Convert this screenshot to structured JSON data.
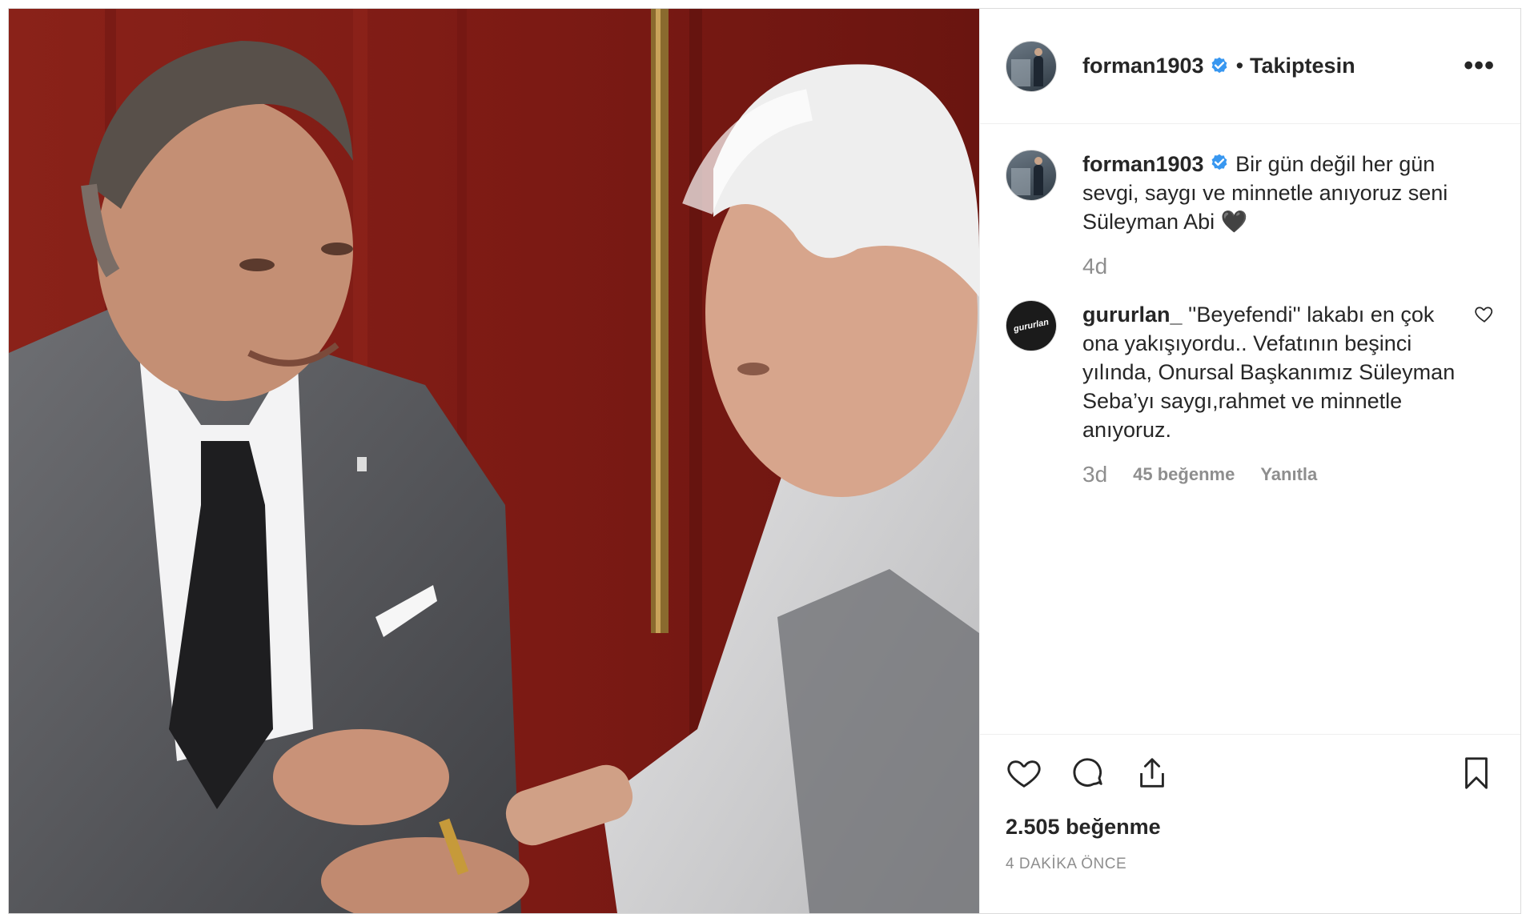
{
  "post": {
    "author": "forman1903",
    "follow_status": "Takiptesin",
    "more_label": "•••",
    "caption": {
      "username": "forman1903",
      "text": "Bir gün değil her gün sevgi, saygı ve minnetle anıyoruz seni Süleyman Abi 🖤",
      "age": "4d"
    },
    "comments": [
      {
        "username": "gururlan_",
        "avatar_text": "gururlan",
        "text": "''Beyefendi'' lakabı en çok ona yakışıyordu.. Vefatının beşinci yılında, Onursal Başkanımız Süleyman Seba’yı saygı,rahmet ve minnetle anıyoruz.",
        "age": "3d",
        "likes": "45 beğenme",
        "reply": "Yanıtla"
      }
    ],
    "likes_count": "2.505 beğenme",
    "timestamp": "4 DAKİKA ÖNCE"
  },
  "icons": {
    "verified": "verified-badge-icon",
    "like": "heart-icon",
    "comment": "comment-bubble-icon",
    "share": "share-icon",
    "save": "bookmark-icon",
    "comment_like": "heart-icon"
  },
  "colors": {
    "verified": "#3897f0",
    "text": "#262626",
    "muted": "#8e8e8e",
    "border": "#dbdbdb"
  }
}
